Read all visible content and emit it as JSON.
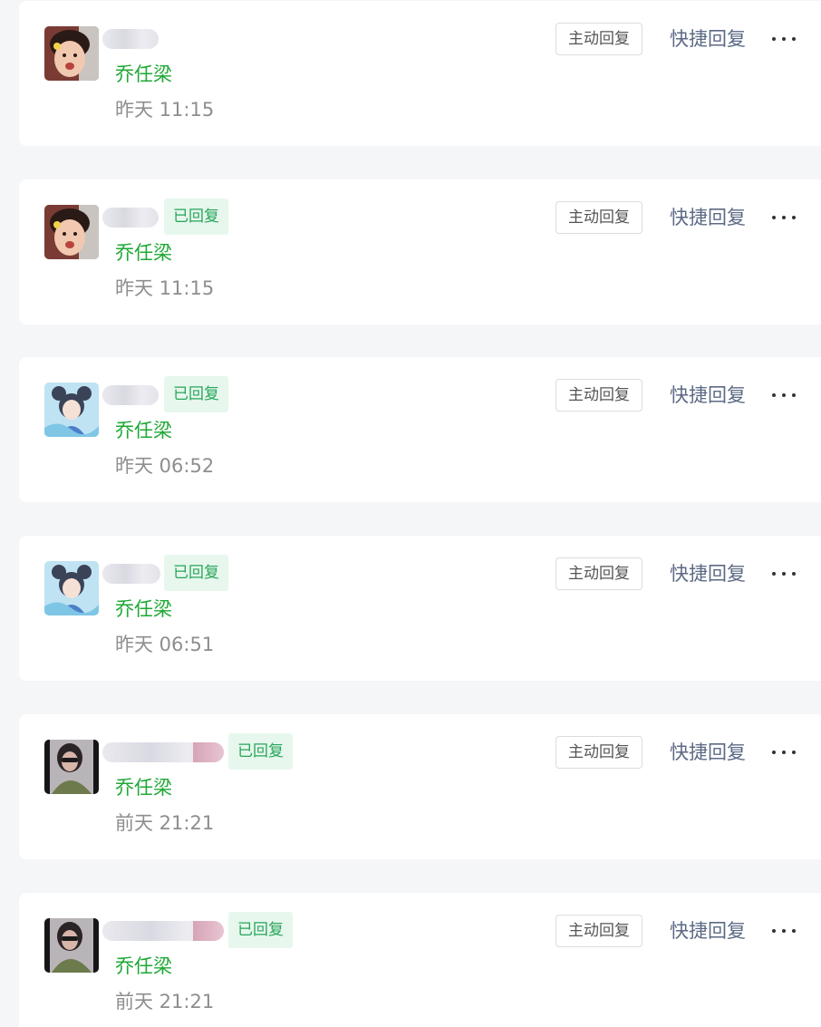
{
  "colors": {
    "page_bg": "#f5f6f8",
    "card_bg": "#ffffff",
    "agent_green": "#1fa835",
    "replied_green": "#27a65a",
    "replied_bg": "#e7f7ed",
    "quick_reply_blue": "#5c6a85",
    "time_gray": "#8e8e8e"
  },
  "actions": {
    "active_reply": "主动回复",
    "quick_reply": "快捷回复",
    "more_icon": "ellipsis-icon"
  },
  "items": [
    {
      "avatar": "child-avatar",
      "replied_label": "",
      "agent": "乔任梁",
      "time": "昨天 11:15"
    },
    {
      "avatar": "child-avatar",
      "replied_label": "已回复",
      "agent": "乔任梁",
      "time": "昨天 11:15"
    },
    {
      "avatar": "anime-girl-avatar",
      "replied_label": "已回复",
      "agent": "乔任梁",
      "time": "昨天 06:52"
    },
    {
      "avatar": "anime-girl-avatar",
      "replied_label": "已回复",
      "agent": "乔任梁",
      "time": "昨天 06:51"
    },
    {
      "avatar": "woman-photo-avatar",
      "replied_label": "已回复",
      "agent": "乔任梁",
      "time": "前天 21:21"
    },
    {
      "avatar": "woman-photo-avatar",
      "replied_label": "已回复",
      "agent": "乔任梁",
      "time": "前天 21:21"
    }
  ]
}
